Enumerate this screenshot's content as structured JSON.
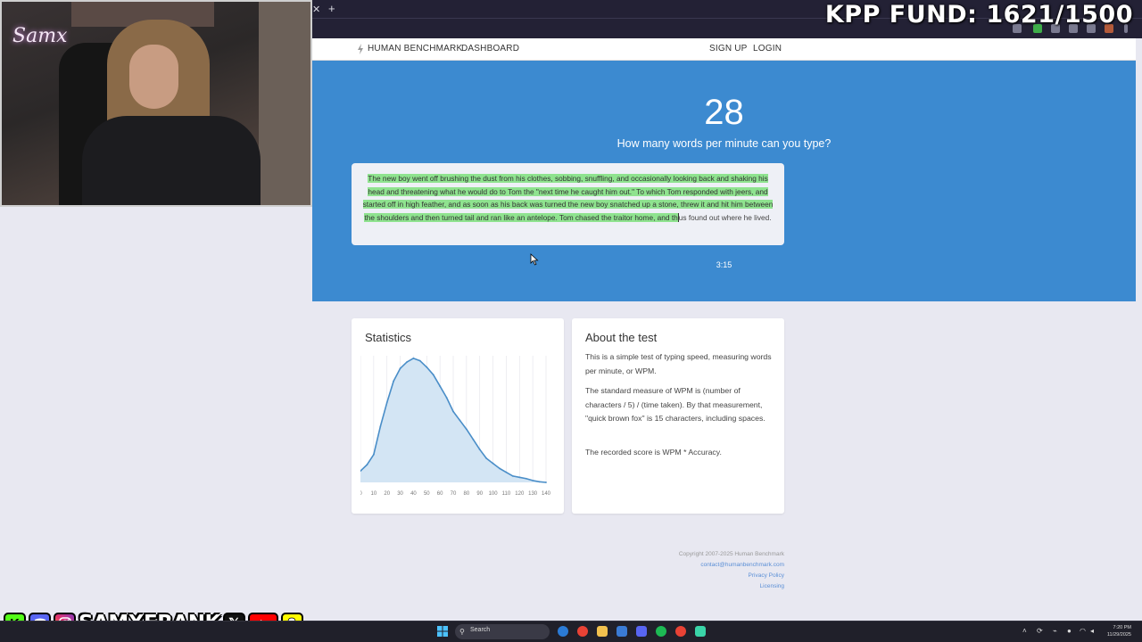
{
  "overlay": {
    "fund_text": "KPP FUND: 1621/1500",
    "cam_logo": "Samx",
    "handle": "SAMXFRANK",
    "social_icons": [
      "kick-icon",
      "discord-icon",
      "instagram-icon",
      "x-icon",
      "youtube-icon",
      "snapchat-icon"
    ]
  },
  "nav": {
    "brand": "HUMAN BENCHMARK",
    "dashboard": "DASHBOARD",
    "signup": "SIGN UP",
    "login": "LOGIN"
  },
  "test": {
    "wpm": "28",
    "question": "How many words per minute can you type?",
    "typed_text": "The new boy went off brushing the dust from his clothes, sobbing, snuffling, and occasionally looking back and shaking his head and threatening what he would do to Tom the \"next time he caught him out.\" To which Tom responded with jeers, and started off in high feather, and as soon as his back was turned the new boy snatched up a stone, threw it and hit him between the shoulders and then turned tail and ran like an antelope. Tom chased the traitor home, and th",
    "remaining_text": "us found out where he lived.",
    "timer": "3:15"
  },
  "statistics": {
    "title": "Statistics"
  },
  "about": {
    "title": "About the test",
    "p1": "This is a simple test of typing speed, measuring words per minute, or WPM.",
    "p2": "The standard measure of WPM is (number of characters / 5) / (time taken). By that measurement, \"quick brown fox\" is 15 characters, including spaces.",
    "p3": "The recorded score is WPM * Accuracy."
  },
  "footer": {
    "copyright": "Copyright 2007-2025 Human Benchmark",
    "contact": "contact@humanbenchmark.com",
    "privacy": "Privacy Policy",
    "licensing": "Licensing"
  },
  "taskbar": {
    "search_label": "Search",
    "time": "7:20 PM",
    "date": "11/29/2025"
  },
  "chart_data": {
    "type": "area",
    "title": "",
    "xlabel": "",
    "ylabel": "",
    "x": [
      0,
      5,
      10,
      15,
      20,
      25,
      30,
      35,
      40,
      45,
      50,
      55,
      60,
      65,
      70,
      75,
      80,
      85,
      90,
      95,
      100,
      105,
      110,
      115,
      120,
      125,
      130,
      135,
      140
    ],
    "y": [
      0.09,
      0.14,
      0.22,
      0.44,
      0.63,
      0.8,
      0.9,
      0.95,
      0.98,
      0.96,
      0.91,
      0.85,
      0.76,
      0.67,
      0.56,
      0.49,
      0.42,
      0.34,
      0.26,
      0.19,
      0.15,
      0.11,
      0.08,
      0.05,
      0.04,
      0.03,
      0.015,
      0.005,
      0.0
    ],
    "xticks": [
      0,
      10,
      20,
      30,
      40,
      50,
      60,
      70,
      80,
      90,
      100,
      110,
      120,
      130,
      140
    ],
    "xlim": [
      0,
      140
    ],
    "ylim": [
      0,
      1
    ],
    "grid": true,
    "line_color": "#4a8ec8",
    "fill_color": "#d3e5f4"
  }
}
